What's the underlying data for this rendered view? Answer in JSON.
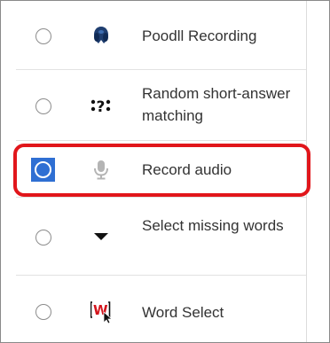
{
  "question_types": [
    {
      "label": "Poodll Recording",
      "icon": "poodll-dog-icon",
      "selected": false
    },
    {
      "label": "Random short-answer matching",
      "icon": "random-shortanswer-icon",
      "selected": false
    },
    {
      "label": "Record audio",
      "icon": "microphone-icon",
      "selected": true
    },
    {
      "label": "Select missing words",
      "icon": "dropdown-triangle-icon",
      "selected": false
    },
    {
      "label": "Word Select",
      "icon": "word-select-icon",
      "selected": false
    }
  ],
  "colors": {
    "highlight": "#e1161b",
    "selected_radio": "#2f6fd3",
    "text": "#333333"
  }
}
